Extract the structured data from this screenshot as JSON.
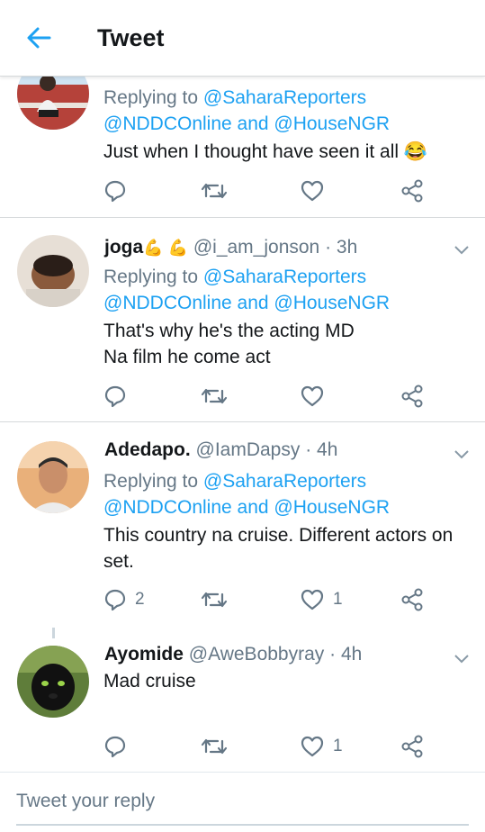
{
  "header": {
    "title": "Tweet"
  },
  "tweets": [
    {
      "reply_to_prefix": "Replying to ",
      "reply_to_first": "@SaharaReporters",
      "reply_to_rest": "@NDDCOnline and @HouseNGR",
      "text_lines": [
        "Just when I thought have seen it all 😂"
      ]
    },
    {
      "name": "joga",
      "name_emoji": "💪 💪",
      "handle": "@i_am_jonson",
      "time": "· 3h",
      "reply_to_prefix": "Replying to ",
      "reply_to_first": "@SaharaReporters",
      "reply_to_rest": "@NDDCOnline and @HouseNGR",
      "text_lines": [
        "That's why he's the acting MD",
        "Na film he come act"
      ]
    },
    {
      "name": "Adedapo.",
      "handle": "@IamDapsy",
      "time": "· 4h",
      "reply_to_prefix": "Replying to ",
      "reply_to_first": "@SaharaReporters",
      "reply_to_rest": "@NDDCOnline and @HouseNGR",
      "text_lines": [
        "This country na cruise. Different actors on",
        "set."
      ],
      "reply_count": "2",
      "like_count": "1"
    },
    {
      "name": "Ayomide",
      "handle": "@AweBobbyray",
      "time": "· 4h",
      "text_lines": [
        "Mad cruise"
      ],
      "like_count": "1"
    }
  ],
  "compose": {
    "placeholder": "Tweet your reply"
  },
  "colors": {
    "accent": "#1da1f2",
    "secondary_text": "#657786",
    "divider": "#d6d9db"
  },
  "icons": [
    "back-arrow-icon",
    "reply-icon",
    "retweet-icon",
    "like-icon",
    "share-icon",
    "chevron-down-icon"
  ]
}
